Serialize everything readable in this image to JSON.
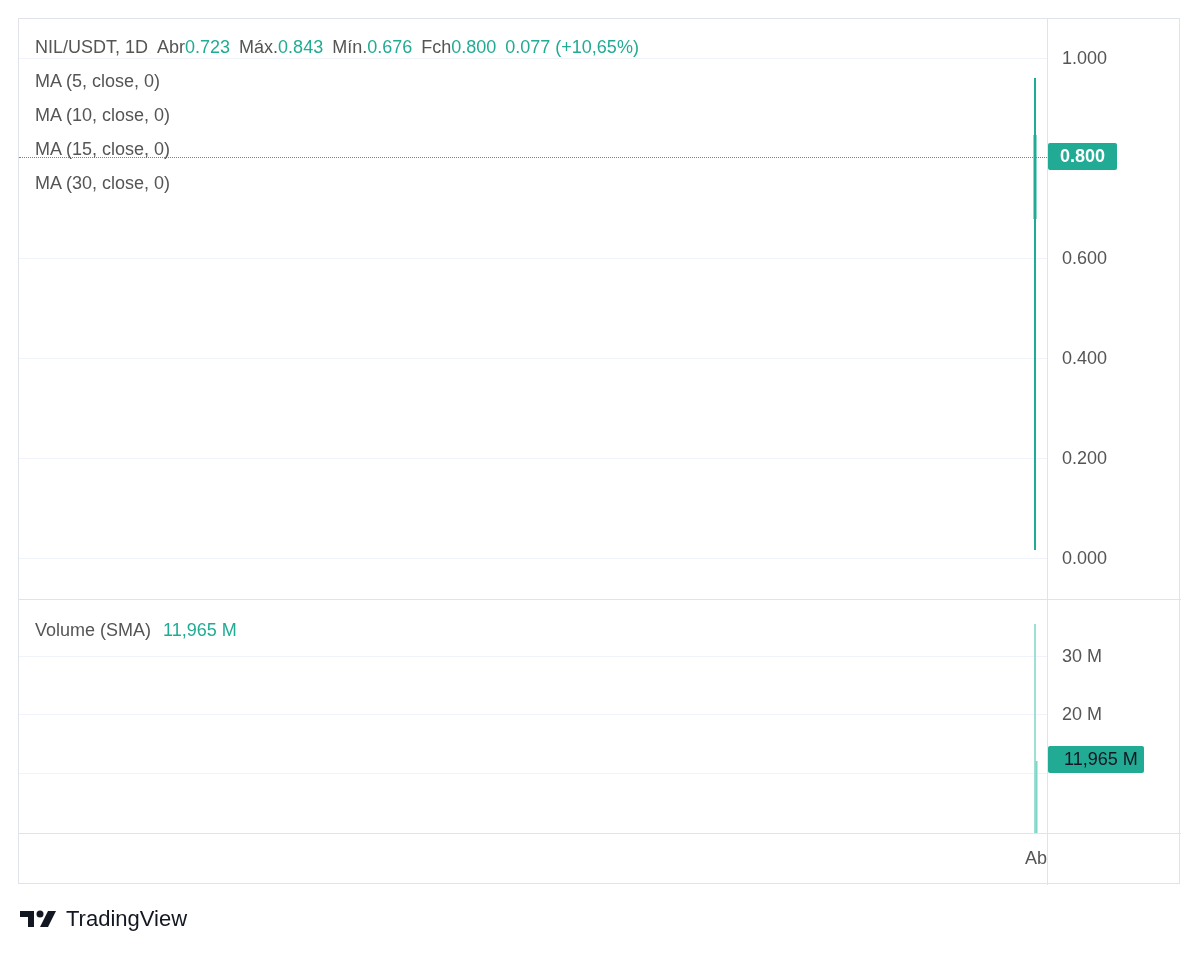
{
  "legend": {
    "symbol": "NIL/USDT, 1D",
    "fields": [
      {
        "label": "Abr",
        "value": "0.723"
      },
      {
        "label": "Máx.",
        "value": "0.843"
      },
      {
        "label": "Mín.",
        "value": "0.676"
      },
      {
        "label": "Fch",
        "value": "0.800"
      }
    ],
    "change": "0.077 (+10,65%)"
  },
  "indicators": [
    "MA (5, close, 0)",
    "MA (10, close, 0)",
    "MA (15, close, 0)",
    "MA (30, close, 0)"
  ],
  "price_axis": {
    "labels": [
      "1.000",
      "0.600",
      "0.400",
      "0.200",
      "0.000"
    ],
    "last_price": "0.800"
  },
  "volume": {
    "label": "Volume (SMA)",
    "value": "11,965 M",
    "axis_labels": [
      "30 M",
      "20 M"
    ],
    "last_value": "11,965 M"
  },
  "time_axis": {
    "labels": [
      "Ab"
    ]
  },
  "branding": {
    "name": "TradingView"
  }
}
